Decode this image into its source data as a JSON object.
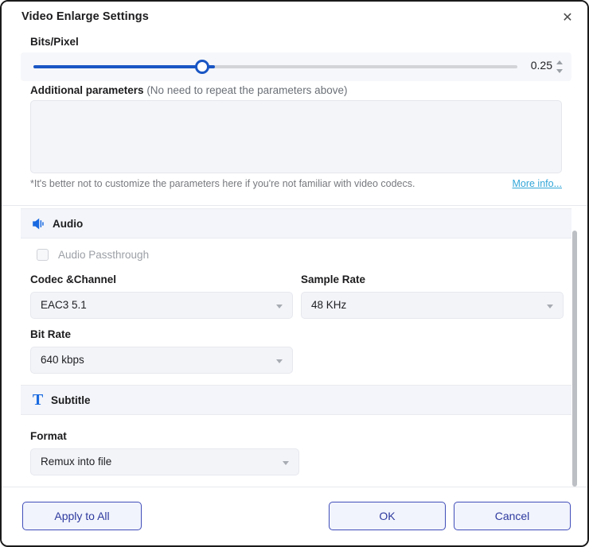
{
  "window": {
    "title": "Video Enlarge Settings",
    "close_icon": "close-icon"
  },
  "video_section": {
    "bits_pixel_label": "Bits/Pixel",
    "bits_pixel_value": "0.25",
    "slider_percent": 37,
    "additional_label": "Additional parameters",
    "additional_hint": "(No need to repeat the parameters above)",
    "additional_value": "",
    "additional_placeholder": "",
    "footnote": "*It's better not to customize the parameters here if you're not familiar with video codecs.",
    "footnote_link": "More info..."
  },
  "audio_section": {
    "header": "Audio",
    "header_icon": "speaker-icon",
    "passthrough_label": "Audio Passthrough",
    "passthrough_checked": false,
    "codec_label": "Codec &Channel",
    "codec_value": "EAC3 5.1",
    "sample_rate_label": "Sample Rate",
    "sample_rate_value": "48 KHz",
    "bit_rate_label": "Bit Rate",
    "bit_rate_value": "640 kbps"
  },
  "subtitle_section": {
    "header": "Subtitle",
    "header_icon": "text-format-icon",
    "format_label": "Format",
    "format_value": "Remux into file"
  },
  "footer": {
    "apply_to_all": "Apply to All",
    "ok": "OK",
    "cancel": "Cancel"
  },
  "colors": {
    "accent_blue": "#1a56c4",
    "button_border": "#3f4db8",
    "link_blue": "#32a6d8",
    "panel_bg": "#f3f5fa"
  }
}
